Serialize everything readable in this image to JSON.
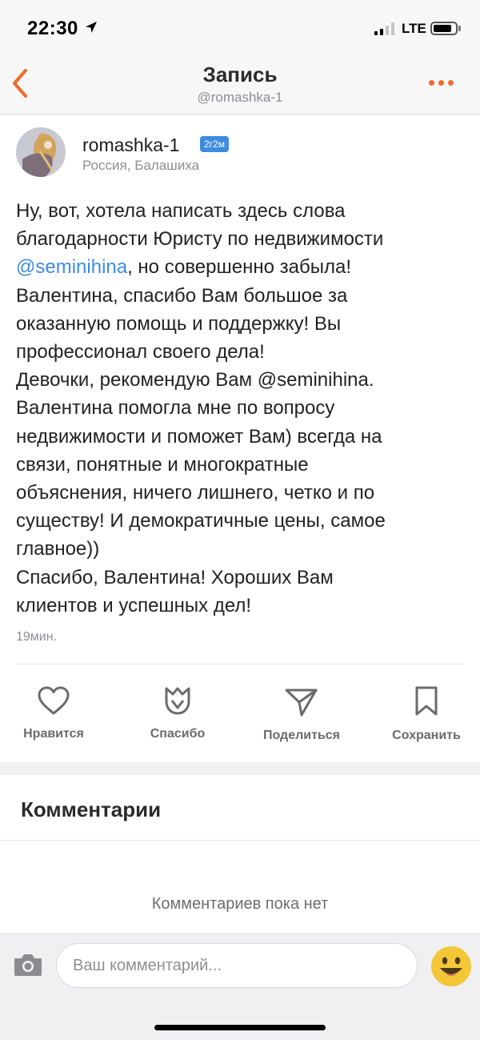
{
  "status_bar": {
    "time": "22:30",
    "network": "LTE",
    "location_icon": "location-arrow-icon",
    "signal_bars": 4,
    "signal_active": 2,
    "battery_level": 0.7
  },
  "nav": {
    "title": "Запись",
    "subtitle": "@romashka-1",
    "back_icon": "chevron-left-icon",
    "more_icon": "more-dots-icon",
    "accent_color": "#f06a2a"
  },
  "author": {
    "name": "romashka-1",
    "badge": "2г2м",
    "location": "Россия, Балашиха"
  },
  "post": {
    "lines": [
      "Ну, вот, хотела написать здесь слова",
      "благодарности Юристу по недвижимости",
      {
        "mention": "@seminihina",
        "rest": ", но совершенно забыла!"
      },
      "Валентина, спасибо Вам большое за",
      "оказанную помощь и поддержку! Вы",
      "профессионал своего дела!",
      "Девочки, рекомендую Вам @seminihina.",
      "Валентина помогла мне по вопросу",
      "недвижимости и поможет Вам) всегда на",
      "связи, понятные и многократные",
      "объяснения, ничего лишнего, четко и по",
      "существу! И демократичные цены, самое",
      "главное))",
      "Спасибо, Валентина! Хороших Вам",
      "клиентов и успешных дел!"
    ],
    "time": "19мин.",
    "link_color": "#3e8be0"
  },
  "actions": {
    "like": {
      "label": "Нравится",
      "icon": "heart-icon"
    },
    "thanks": {
      "label": "Спасибо",
      "icon": "tulip-icon"
    },
    "share": {
      "label": "Поделиться",
      "icon": "paper-plane-icon"
    },
    "save": {
      "label": "Сохранить",
      "icon": "bookmark-icon"
    }
  },
  "comments": {
    "title": "Комментарии",
    "empty_text": "Комментариев пока нет"
  },
  "composer": {
    "placeholder": "Ваш комментарий...",
    "camera_icon": "camera-icon",
    "emoji_icon": "emoji-icon"
  }
}
